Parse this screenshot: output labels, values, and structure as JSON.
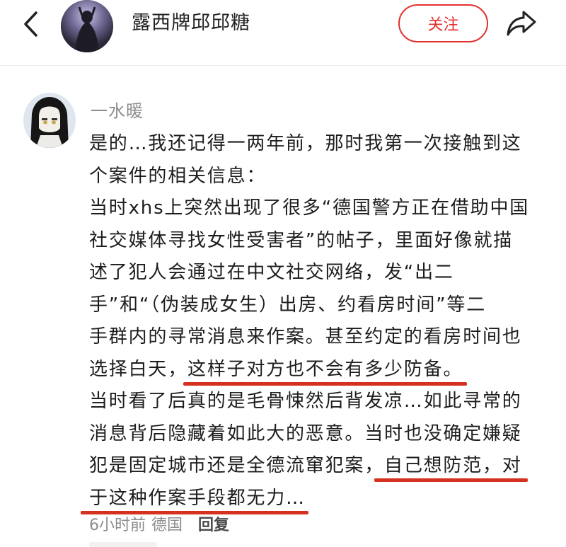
{
  "header": {
    "back_icon": "chevron-left-icon",
    "author_name": "露西牌邱邱糖",
    "follow_label": "关注",
    "share_icon": "share-arrow-icon",
    "accent_color": "#e3312f"
  },
  "comment": {
    "author": "一水暖",
    "lines": [
      "是的…我还记得一两年前，那时我第一次接触到这",
      "个案件的相关信息：",
      "当时xhs上突然出现了很多“德国警方正在借助中国",
      "社交媒体寻找女性受害者”的帖子，里面好像就描",
      "述了犯人会通过在中文社交网络，发“出二",
      "手”和“（伪装成女生）出房、约看房时间”等二",
      "手群内的寻常消息来作案。甚至约定的看房时间也"
    ],
    "line8_prefix": "选择白天，",
    "line8_highlight": "这样子对方也不会有多少防备。",
    "line9": "当时看了后真的是毛骨悚然后背发凉…如此寻常的",
    "line10": "消息背后隐藏着如此大的恶意。当时也没确定嫌疑",
    "line11_prefix": "犯是固定城市还是全德流窜犯案，",
    "line11_highlight": "自己想防范，对",
    "line12_highlight": "于这种作案手段都无力…",
    "time": "6小时前",
    "location": "德国",
    "reply_label": "回复",
    "highlight_color": "#d5311f"
  }
}
